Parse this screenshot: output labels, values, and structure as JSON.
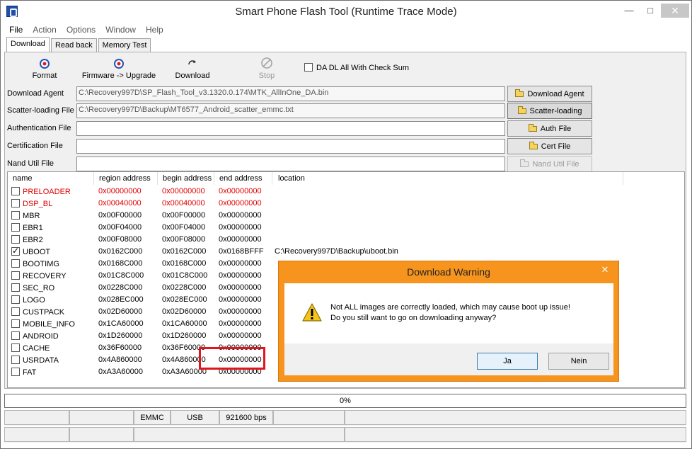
{
  "window": {
    "title": "Smart Phone Flash Tool (Runtime Trace Mode)",
    "min_glyph": "—",
    "max_glyph": "□",
    "close_glyph": "✕"
  },
  "menu": [
    "File",
    "Action",
    "Options",
    "Window",
    "Help"
  ],
  "tabs": [
    "Download",
    "Read back",
    "Memory Test"
  ],
  "toolbar": {
    "format": "Format",
    "firmware_upgrade": "Firmware -> Upgrade",
    "download": "Download",
    "stop": "Stop",
    "checksum_label": "DA DL All With Check Sum"
  },
  "files": {
    "download_agent": {
      "label": "Download Agent",
      "value": "C:\\Recovery997D\\SP_Flash_Tool_v3.1320.0.174\\MTK_AllInOne_DA.bin",
      "button": "Download Agent"
    },
    "scatter": {
      "label": "Scatter-loading File",
      "value": "C:\\Recovery997D\\Backup\\MT6577_Android_scatter_emmc.txt",
      "button": "Scatter-loading"
    },
    "auth": {
      "label": "Authentication File",
      "value": "",
      "button": "Auth File"
    },
    "cert": {
      "label": "Certification File",
      "value": "",
      "button": "Cert File"
    },
    "nand": {
      "label": "Nand Util File",
      "value": "",
      "button": "Nand Util File"
    }
  },
  "table": {
    "headers": [
      "name",
      "region address",
      "begin address",
      "end address",
      "location"
    ],
    "rows": [
      {
        "name": "PRELOADER",
        "region": "0x00000000",
        "begin": "0x00000000",
        "end": "0x00000000",
        "location": ""
      },
      {
        "name": "DSP_BL",
        "region": "0x00040000",
        "begin": "0x00040000",
        "end": "0x00000000",
        "location": ""
      },
      {
        "name": "MBR",
        "region": "0x00F00000",
        "begin": "0x00F00000",
        "end": "0x00000000",
        "location": ""
      },
      {
        "name": "EBR1",
        "region": "0x00F04000",
        "begin": "0x00F04000",
        "end": "0x00000000",
        "location": ""
      },
      {
        "name": "EBR2",
        "region": "0x00F08000",
        "begin": "0x00F08000",
        "end": "0x00000000",
        "location": ""
      },
      {
        "name": "UBOOT",
        "region": "0x0162C000",
        "begin": "0x0162C000",
        "end": "0x0168BFFF",
        "location": "C:\\Recovery997D\\Backup\\uboot.bin"
      },
      {
        "name": "BOOTIMG",
        "region": "0x0168C000",
        "begin": "0x0168C000",
        "end": "0x00000000",
        "location": ""
      },
      {
        "name": "RECOVERY",
        "region": "0x01C8C000",
        "begin": "0x01C8C000",
        "end": "0x00000000",
        "location": ""
      },
      {
        "name": "SEC_RO",
        "region": "0x0228C000",
        "begin": "0x0228C000",
        "end": "0x00000000",
        "location": ""
      },
      {
        "name": "LOGO",
        "region": "0x028EC000",
        "begin": "0x028EC000",
        "end": "0x00000000",
        "location": ""
      },
      {
        "name": "CUSTPACK",
        "region": "0x02D60000",
        "begin": "0x02D60000",
        "end": "0x00000000",
        "location": ""
      },
      {
        "name": "MOBILE_INFO",
        "region": "0x1CA60000",
        "begin": "0x1CA60000",
        "end": "0x00000000",
        "location": ""
      },
      {
        "name": "ANDROID",
        "region": "0x1D260000",
        "begin": "0x1D260000",
        "end": "0x00000000",
        "location": ""
      },
      {
        "name": "CACHE",
        "region": "0x36F60000",
        "begin": "0x36F60000",
        "end": "0x00000000",
        "location": ""
      },
      {
        "name": "USRDATA",
        "region": "0x4A860000",
        "begin": "0x4A860000",
        "end": "0x00000000",
        "location": ""
      },
      {
        "name": "FAT",
        "region": "0xA3A60000",
        "begin": "0xA3A60000",
        "end": "0x00000000",
        "location": ""
      }
    ],
    "red_rows": [
      "PRELOADER",
      "DSP_BL"
    ],
    "checked_rows": [
      "UBOOT"
    ]
  },
  "progress": {
    "text": "0%",
    "fraction": 0
  },
  "status": {
    "storage": "EMMC",
    "interface": "USB",
    "baud": "921600 bps"
  },
  "dialog": {
    "title": "Download Warning",
    "close_glyph": "✕",
    "line1": "Not ALL images are correctly loaded, which may cause boot up issue!",
    "line2": "Do you still want to go on downloading anyway?",
    "yes": "Ja",
    "no": "Nein"
  },
  "colors": {
    "dialog_frame": "#f7941d",
    "red_text": "#e00000",
    "highlight": "#e0161c",
    "progress": "#06b025"
  }
}
